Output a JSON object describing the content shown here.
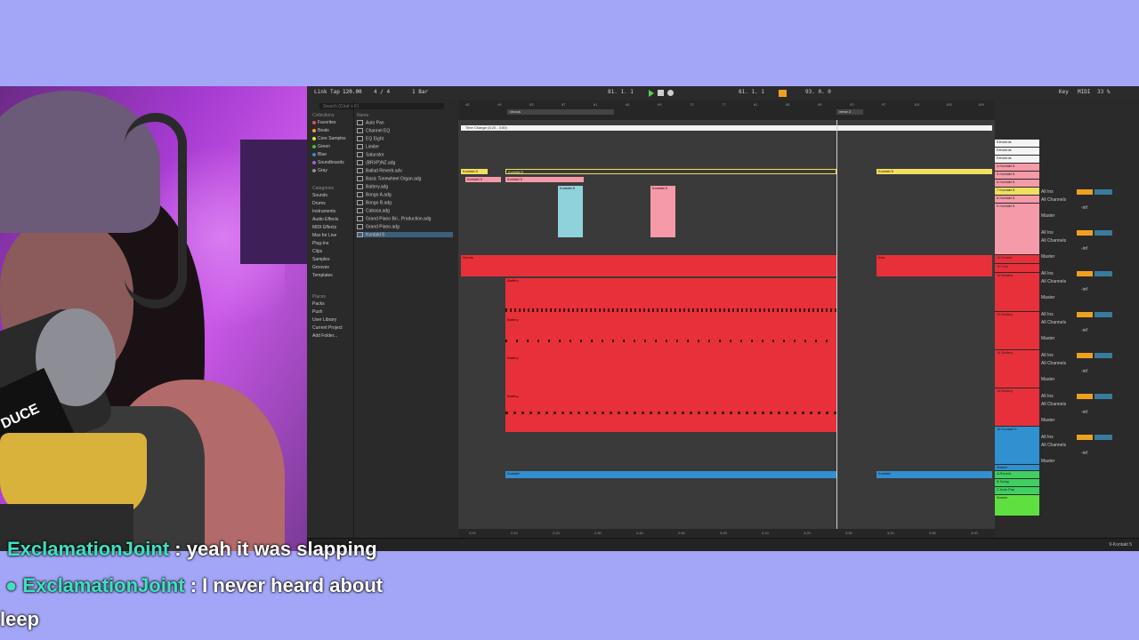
{
  "daw": {
    "transport": {
      "tempo": "120.00",
      "signature": "4 / 4",
      "quantize": "1 Bar",
      "position": "81. 1. 1",
      "loop_end": "93. 0. 0",
      "key": "Key",
      "midi": "MIDI",
      "cpu": "33 %"
    },
    "browser": {
      "search_placeholder": "Search (Cmd + F)",
      "collections_header": "Collections",
      "collections": [
        {
          "label": "Favorites",
          "color": "#e05050"
        },
        {
          "label": "Beats",
          "color": "#f0a030"
        },
        {
          "label": "Core Samples",
          "color": "#e0e040"
        },
        {
          "label": "Green",
          "color": "#40c040"
        },
        {
          "label": "Blue",
          "color": "#4080e0"
        },
        {
          "label": "Soundboards",
          "color": "#a060e0"
        },
        {
          "label": "Gray",
          "color": "#909090"
        }
      ],
      "categories_header": "Categories",
      "categories": [
        "Sounds",
        "Drums",
        "Instruments",
        "Audio Effects",
        "MIDI Effects",
        "Max for Live",
        "Plug-Ins",
        "Clips",
        "Samples",
        "Grooves",
        "Templates"
      ],
      "places_header": "Places",
      "places": [
        "Packs",
        "Push",
        "User Library",
        "Current Project",
        "Add Folder..."
      ],
      "name_header": "Name",
      "files": [
        "Auto Pan",
        "Channel EQ",
        "EQ Eight",
        "Limiter",
        "Saturator",
        "(BRXP)NZ.adg",
        "Ballad Reverb.adv",
        "Basic Tonewheel Organ.adg",
        "Battery.adg",
        "Bongo A.adg",
        "Bongo B.adg",
        "Cabasa.adg",
        "Grand Piano Bri...Production.adg",
        "Grand Piano.adg",
        "Kontakt 5"
      ]
    },
    "arrangement": {
      "ruler_ticks": [
        "45",
        "49",
        "53",
        "57",
        "61",
        "65",
        "69",
        "73",
        "77",
        "81",
        "85",
        "89",
        "93",
        "97",
        "101",
        "105",
        "109"
      ],
      "locators": [
        "chorus",
        "verse 2"
      ],
      "time_change": "Time Change (3:20 - 3:50)",
      "time_ticks": [
        "2:00",
        "2:10",
        "2:20",
        "2:30",
        "2:40",
        "2:50",
        "3:00",
        "3:10",
        "3:20",
        "3:30",
        "3:40",
        "3:50",
        "4:00",
        "4:10",
        "4:20"
      ]
    },
    "tracks": [
      {
        "name": "Elements",
        "color": "#f4f4f4"
      },
      {
        "name": "Elements",
        "color": "#f4f4f4"
      },
      {
        "name": "Elements",
        "color": "#f4f4f4"
      },
      {
        "name": "4 Kontakt 5",
        "color": "#f59aa8"
      },
      {
        "name": "5 Kontakt 5",
        "color": "#f59aa8"
      },
      {
        "name": "6 Kontakt 5",
        "color": "#f59aa8"
      },
      {
        "name": "7 Kontakt 5",
        "color": "#f0e060"
      },
      {
        "name": "8 Kontakt 5",
        "color": "#f59aa8"
      },
      {
        "name": "9 Kontakt 5",
        "color": "#f59aa8"
      },
      {
        "name": "10 Drums",
        "color": "#e8303a"
      },
      {
        "name": "11 Kick",
        "color": "#e8303a"
      },
      {
        "name": "12 Battery",
        "color": "#e8303a"
      },
      {
        "name": "13 Battery",
        "color": "#e8303a"
      },
      {
        "name": "14 Battery",
        "color": "#e8303a"
      },
      {
        "name": "15 Battery",
        "color": "#e8303a"
      },
      {
        "name": "16 Kontakt 5",
        "color": "#3090d0"
      },
      {
        "name": "Master",
        "color": "#3090d0"
      },
      {
        "name": "A Reverb",
        "color": "#40d060"
      },
      {
        "name": "B Delay",
        "color": "#40d060"
      },
      {
        "name": "C Auto Pan",
        "color": "#40d060"
      },
      {
        "name": "Master",
        "color": "#60e040"
      }
    ],
    "clips": {
      "yellow": [
        "Kontakt 5",
        "Kontakt 5",
        "Kontakt 5"
      ],
      "pink": [
        "Kontakt 5",
        "Kontakt 5",
        "Kontakt 5"
      ],
      "cyan": "Kontakt 5",
      "drums": [
        "Drums",
        "Kick",
        "Battery",
        "Battery",
        "Battery",
        "Battery"
      ],
      "blue": [
        "Kontakt",
        "Kontakt"
      ]
    },
    "mixer": {
      "input": "All Ins",
      "channel": "All Channels",
      "output": "Master",
      "in_auto_off": [
        "In",
        "Auto",
        "Off"
      ],
      "inf": "-inf"
    },
    "status_right": "9-Kontakt 5"
  },
  "chat": [
    {
      "user": "ExclamationJoint",
      "message": "yeah it was slapping",
      "user_color": "#3fe0c0"
    },
    {
      "user": "ExclamationJoint",
      "message": "I never heard about",
      "user_color": "#3fe0c0"
    },
    {
      "user": "",
      "message": "leep",
      "user_color": "#ffffff"
    }
  ],
  "cam": {
    "mic_brand": "DUCE"
  }
}
